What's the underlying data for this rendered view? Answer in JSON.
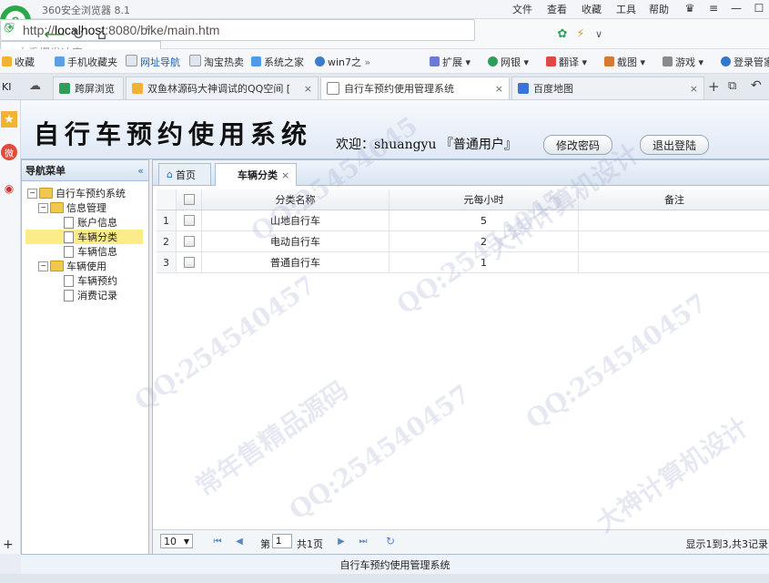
{
  "browser": {
    "app_title": "360安全浏览器 8.1",
    "menu": [
      "文件",
      "查看",
      "收藏",
      "工具",
      "帮助"
    ],
    "url": {
      "prefix": "http://",
      "host": "localhost",
      "rest": ":8080/bike/main.htm"
    },
    "search_placeholder": "古香爆发冲突",
    "bookmarks": [
      "收藏",
      "手机收藏夹",
      "网址导航",
      "淘宝热卖",
      "系统之家",
      "win7之",
      "扩展",
      "网银",
      "翻译",
      "截图",
      "游戏",
      "登录管家"
    ],
    "tabs": [
      {
        "label": "跨屏浏览"
      },
      {
        "label": "双鱼林源码大神调试的QQ空间 [",
        "closable": true
      },
      {
        "label": "自行车预约使用管理系统",
        "closable": true,
        "active": true
      },
      {
        "label": "百度地图",
        "closable": true
      }
    ]
  },
  "app": {
    "title": "自行车预约使用系统",
    "welcome": "欢迎：shuangyu 『普通用户』",
    "change_password": "修改密码",
    "logout": "退出登陆",
    "footer": "自行车预约使用管理系统"
  },
  "nav": {
    "header": "导航菜单",
    "collapse": "«",
    "root": "自行车预约系统",
    "groups": [
      {
        "label": "信息管理",
        "items": [
          "账户信息",
          "车辆分类",
          "车辆信息"
        ]
      },
      {
        "label": "车辆使用",
        "items": [
          "车辆预约",
          "消费记录"
        ]
      }
    ],
    "selected": "车辆分类"
  },
  "content": {
    "tabs": [
      {
        "label": "首页"
      },
      {
        "label": "车辆分类",
        "active": true,
        "closable": true
      }
    ],
    "columns": [
      "分类名称",
      "元每小时",
      "备注"
    ],
    "rows": [
      {
        "n": "1",
        "name": "山地自行车",
        "price": "5",
        "note": ""
      },
      {
        "n": "2",
        "name": "电动自行车",
        "price": "2",
        "note": ""
      },
      {
        "n": "3",
        "name": "普通自行车",
        "price": "1",
        "note": ""
      }
    ],
    "pager": {
      "page_size": "10",
      "page_prefix": "第",
      "page_value": "1",
      "total_pages": "共1页",
      "summary": "显示1到3,共3记录"
    }
  },
  "watermark": [
    "QQ:25454045",
    "大神计算机设计",
    "常年售精品源码",
    "QQ:254540457"
  ]
}
